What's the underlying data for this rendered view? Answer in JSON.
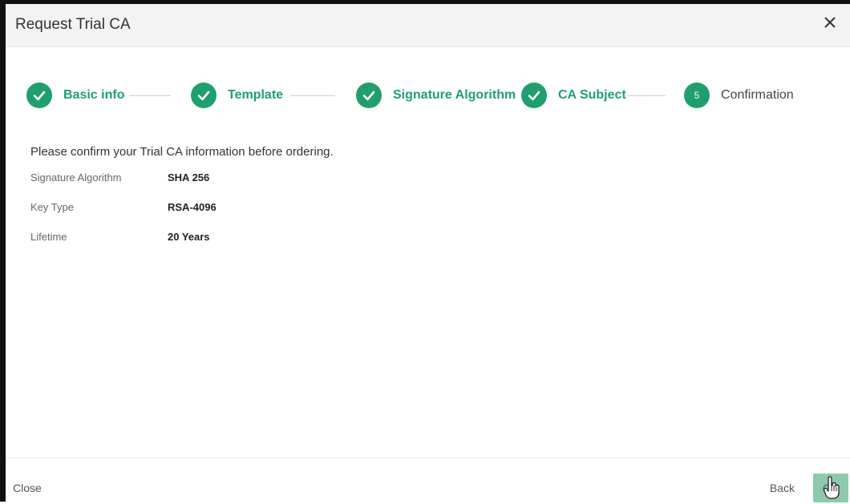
{
  "dialog": {
    "title": "Request Trial CA"
  },
  "stepper": {
    "steps": [
      {
        "label": "Basic info",
        "state": "done"
      },
      {
        "label": "Template",
        "state": "done"
      },
      {
        "label": "Signature Algorithm",
        "state": "done"
      },
      {
        "label": "CA Subject",
        "state": "done"
      },
      {
        "label": "Confirmation",
        "state": "active",
        "number": "5"
      }
    ]
  },
  "content": {
    "intro": "Please confirm your Trial CA information before ordering.",
    "rows": [
      {
        "key": "Signature Algorithm",
        "value": "SHA 256"
      },
      {
        "key": "Key Type",
        "value": "RSA-4096"
      },
      {
        "key": "Lifetime",
        "value": "20 Years"
      }
    ]
  },
  "footer": {
    "close_label": "Close",
    "back_label": "Back",
    "ok_label": "OK"
  },
  "colors": {
    "accent": "#1f9e6e",
    "ok_button": "#8fc9ad"
  },
  "icons": {
    "close": "close-icon",
    "step_done": "check-icon",
    "cursor": "hand-cursor-icon"
  }
}
